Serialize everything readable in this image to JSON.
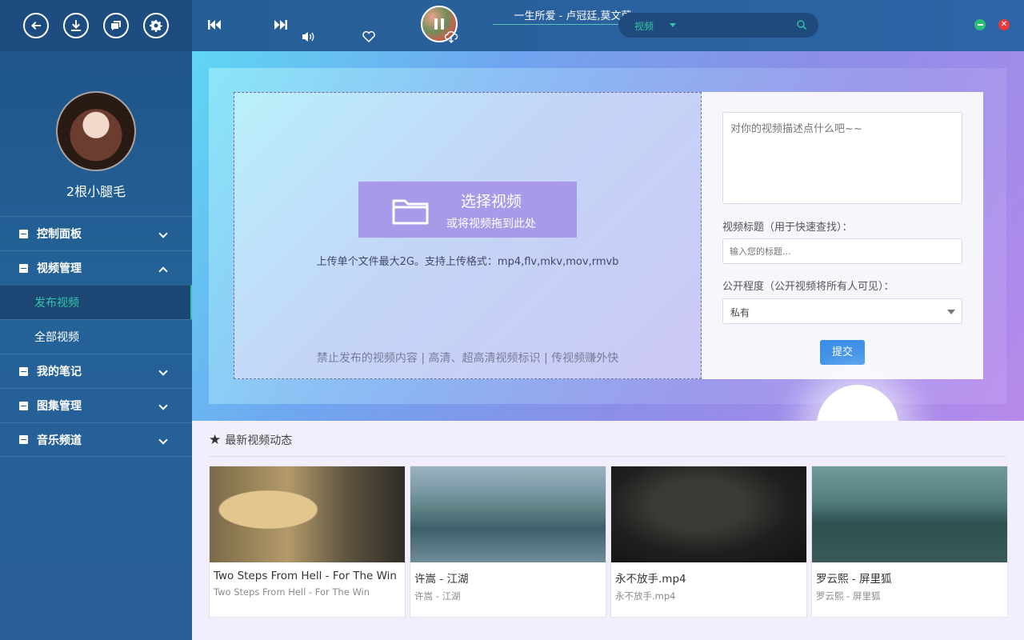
{
  "sidebar": {
    "username": "2根小腿毛",
    "menu": [
      {
        "label": "控制面板"
      },
      {
        "label": "视频管理"
      },
      {
        "label": "我的笔记"
      },
      {
        "label": "图集管理"
      },
      {
        "label": "音乐频道"
      }
    ],
    "video_sub": [
      {
        "label": "发布视频"
      },
      {
        "label": "全部视频"
      }
    ]
  },
  "player": {
    "song_title": "一生所爱 - 卢冠廷,莫文蔚"
  },
  "search": {
    "category": "视频"
  },
  "upload": {
    "choose_main": "选择视频",
    "choose_sub": "或将视频拖到此处",
    "hint": "上传单个文件最大2G。支持上传格式：mp4,flv,mkv,mov,rmvb",
    "ban_text": "禁止发布的视频内容 | 高清、超高清视频标识 | 传视频赚外快"
  },
  "form": {
    "desc_placeholder": "对你的视频描述点什么吧~~",
    "title_label": "视频标题（用于快速查找）：",
    "title_placeholder": "输入您的标题...",
    "privacy_label": "公开程度（公开视频将所有人可见）：",
    "privacy_value": "私有",
    "submit_label": "提交"
  },
  "news": {
    "heading": "最新视频动态",
    "cards": [
      {
        "title": "Two Steps From Hell - For The Win",
        "subtitle": "Two Steps From Hell - For The Win"
      },
      {
        "title": "许嵩 - 江湖",
        "subtitle": "许嵩 - 江湖"
      },
      {
        "title": "永不放手.mp4",
        "subtitle": "永不放手.mp4"
      },
      {
        "title": "罗云熙 - 屏里狐",
        "subtitle": "罗云熙 - 屏里狐"
      }
    ]
  },
  "colors": {
    "accent": "#35c4a8",
    "sidebar": "#1f5388",
    "submit": "#3b8fe8",
    "choose_button": "#a89ae8"
  }
}
